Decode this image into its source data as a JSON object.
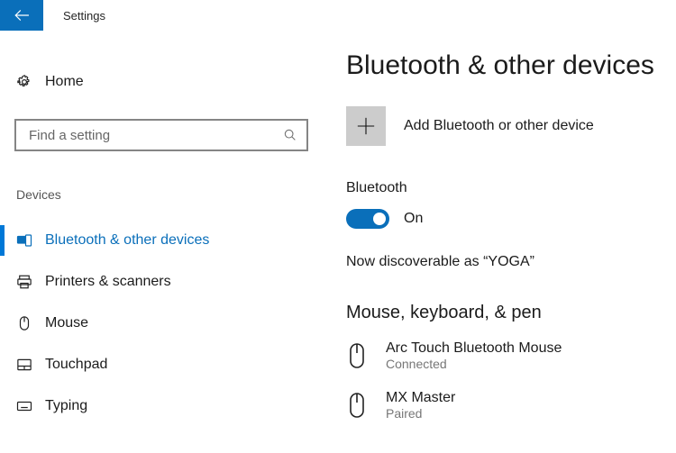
{
  "titlebar": {
    "app_name": "Settings"
  },
  "sidebar": {
    "home_label": "Home",
    "search_placeholder": "Find a setting",
    "category_label": "Devices",
    "items": [
      {
        "label": "Bluetooth & other devices",
        "active": true
      },
      {
        "label": "Printers & scanners"
      },
      {
        "label": "Mouse"
      },
      {
        "label": "Touchpad"
      },
      {
        "label": "Typing"
      }
    ]
  },
  "page": {
    "heading": "Bluetooth & other devices",
    "add_device_label": "Add Bluetooth or other device",
    "bt_section_label": "Bluetooth",
    "bt_toggle_state": "On",
    "discoverable_text": "Now discoverable as “YOGA”",
    "device_list_heading": "Mouse, keyboard, & pen",
    "devices": [
      {
        "name": "Arc Touch Bluetooth Mouse",
        "status": "Connected"
      },
      {
        "name": "MX Master",
        "status": "Paired"
      }
    ]
  }
}
